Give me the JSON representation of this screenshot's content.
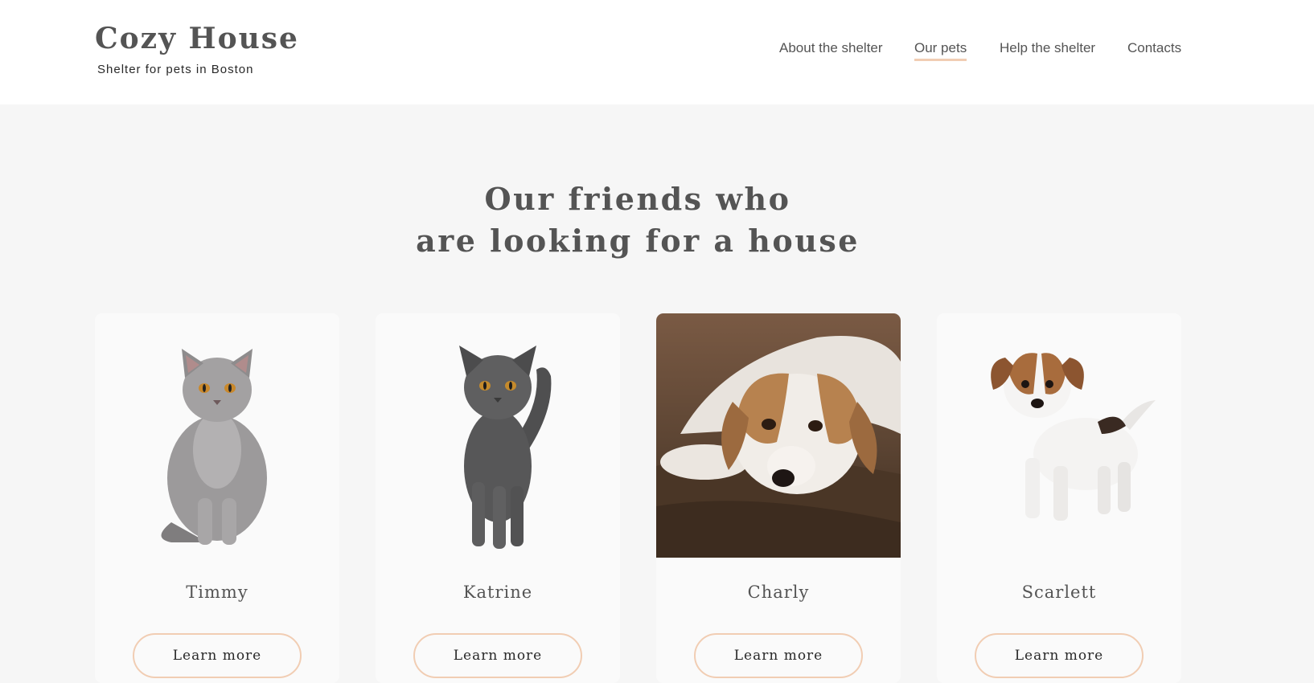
{
  "header": {
    "logo_title": "Cozy House",
    "logo_subtitle": "Shelter for pets in Boston",
    "nav": [
      {
        "label": "About the shelter",
        "active": false
      },
      {
        "label": "Our pets",
        "active": true
      },
      {
        "label": "Help the shelter",
        "active": false
      },
      {
        "label": "Contacts",
        "active": false
      }
    ],
    "accent_color": "#f1cdb3"
  },
  "main": {
    "title_line1": "Our friends who",
    "title_line2": "are looking for a house",
    "pets": [
      {
        "name": "Timmy",
        "image": "gray-cat-photo",
        "button_label": "Learn more"
      },
      {
        "name": "Katrine",
        "image": "dark-gray-cat-photo",
        "button_label": "Learn more"
      },
      {
        "name": "Charly",
        "image": "dog-photo",
        "button_label": "Learn more"
      },
      {
        "name": "Scarlett",
        "image": "puppy-photo",
        "button_label": "Learn more"
      }
    ]
  },
  "colors": {
    "background": "#f6f6f6",
    "card_background": "#fafafa",
    "text_dark": "#545454",
    "text_black": "#292929"
  }
}
